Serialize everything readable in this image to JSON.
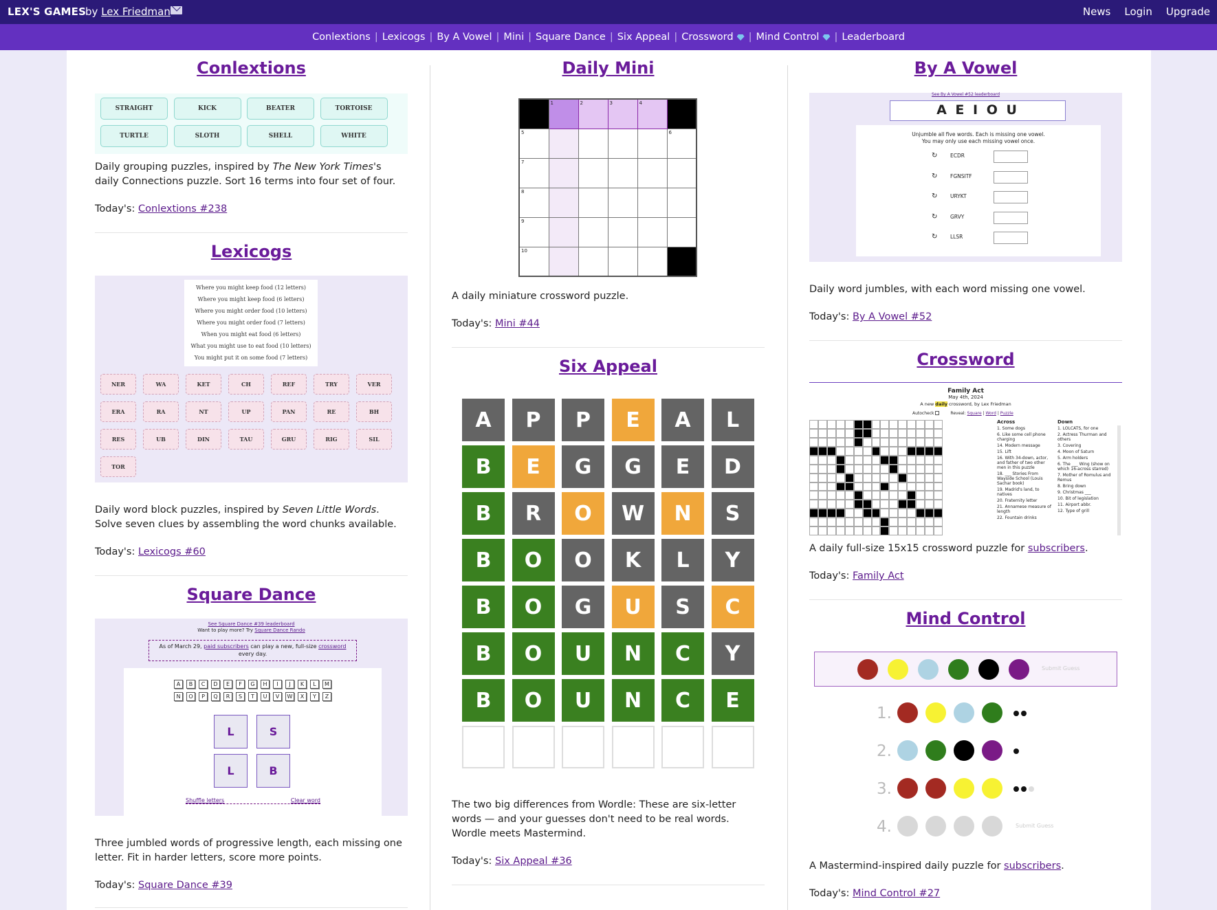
{
  "topbar": {
    "brand": "LEX'S GAMES",
    "by": "by",
    "author": "Lex Friedman",
    "links": [
      "News",
      "Login",
      "Upgrade"
    ]
  },
  "nav": {
    "items": [
      "Conlextions",
      "Lexicogs",
      "By A Vowel",
      "Mini",
      "Square Dance",
      "Six Appeal",
      "Crossword",
      "Mind Control",
      "Leaderboard"
    ],
    "gem_items": [
      "Crossword",
      "Mind Control"
    ]
  },
  "conlextions": {
    "title": "Conlextions",
    "tiles": [
      "STRAIGHT",
      "KICK",
      "BEATER",
      "TORTOISE",
      "TURTLE",
      "SLOTH",
      "SHELL",
      "WHITE"
    ],
    "desc_pre": "Daily grouping puzzles, inspired by ",
    "desc_em": "The New York Times",
    "desc_post": "'s daily Connections puzzle. Sort 16 terms into four set of four.",
    "today_label": "Today's:",
    "today_link": "Conlextions #238"
  },
  "lexicogs": {
    "title": "Lexicogs",
    "clues": [
      "Where you might keep food (12 letters)",
      "Where you might keep food (6 letters)",
      "Where you might order food (10 letters)",
      "Where you might order food (7 letters)",
      "When you might eat food (6 letters)",
      "What you might use to eat food (10 letters)",
      "You might put it on some food (7 letters)"
    ],
    "chunks": [
      "NER",
      "WA",
      "KET",
      "CH",
      "REF",
      "TRY",
      "VER",
      "ERA",
      "RA",
      "NT",
      "UP",
      "PAN",
      "RE",
      "BH",
      "RES",
      "UB",
      "DIN",
      "TAU",
      "GRU",
      "RIG",
      "SIL",
      "TOR"
    ],
    "desc_pre": "Daily word block puzzles, inspired by ",
    "desc_em": "Seven Little Words",
    "desc_post": ". Solve seven clues by assembling the word chunks available.",
    "today_label": "Today's:",
    "today_link": "Lexicogs #60"
  },
  "squaredance": {
    "title": "Square Dance",
    "lb_link": "See Square Dance #39 leaderboard",
    "more_pre": "Want to play more? Try ",
    "more_link": "Square Dance Rando",
    "notice_pre": "As of March 29, ",
    "notice_link": "paid subscribers",
    "notice_mid": " can play a new, full-size ",
    "notice_link2": "crossword",
    "notice_post": " every day.",
    "keys1": [
      "A",
      "B",
      "C",
      "D",
      "E",
      "F",
      "G",
      "H",
      "I",
      "J",
      "K",
      "L",
      "M"
    ],
    "keys2": [
      "N",
      "O",
      "P",
      "Q",
      "R",
      "S",
      "T",
      "U",
      "V",
      "W",
      "X",
      "Y",
      "Z"
    ],
    "grid": [
      "L",
      "S",
      "L",
      "B"
    ],
    "shuffle": "Shuffle letters",
    "clear": "Clear word",
    "desc": "Three jumbled words of progressive length, each missing one letter. Fit in harder letters, score more points.",
    "today_label": "Today's:",
    "today_link": "Square Dance #39"
  },
  "mini": {
    "title": "Daily Mini",
    "numbers": [
      "1",
      "2",
      "3",
      "4",
      "5",
      "6",
      "7",
      "8",
      "9",
      "10"
    ],
    "desc": "A daily miniature crossword puzzle.",
    "today_label": "Today's:",
    "today_link": "Mini #44"
  },
  "sixappeal": {
    "title": "Six Appeal",
    "rows": [
      [
        "A",
        "P",
        "P",
        "E",
        "A",
        "L"
      ],
      [
        "B",
        "E",
        "G",
        "G",
        "E",
        "D"
      ],
      [
        "B",
        "R",
        "O",
        "W",
        "N",
        "S"
      ],
      [
        "B",
        "O",
        "O",
        "K",
        "L",
        "Y"
      ],
      [
        "B",
        "O",
        "G",
        "U",
        "S",
        "C"
      ],
      [
        "B",
        "O",
        "U",
        "N",
        "C",
        "Y"
      ],
      [
        "B",
        "O",
        "U",
        "N",
        "C",
        "E"
      ],
      [
        "",
        "",
        "",
        "",
        "",
        ""
      ]
    ],
    "colors": [
      [
        "d",
        "d",
        "d",
        "y",
        "d",
        "d"
      ],
      [
        "g",
        "y",
        "d",
        "d",
        "d",
        "d"
      ],
      [
        "g",
        "d",
        "y",
        "d",
        "y",
        "d"
      ],
      [
        "g",
        "g",
        "d",
        "d",
        "d",
        "d"
      ],
      [
        "g",
        "g",
        "d",
        "y",
        "d",
        "y"
      ],
      [
        "g",
        "g",
        "g",
        "g",
        "g",
        "d"
      ],
      [
        "g",
        "g",
        "g",
        "g",
        "g",
        "g"
      ],
      [
        "e",
        "e",
        "e",
        "e",
        "e",
        "e"
      ]
    ],
    "desc": "The two big differences from Wordle: These are six-letter words — and your guesses don't need to be real words. Wordle meets Mastermind.",
    "today_label": "Today's:",
    "today_link": "Six Appeal #36"
  },
  "byavowel": {
    "title": "By A Vowel",
    "lb_link": "See By A Vowel #52 leaderboard",
    "vowels": "A E I O U",
    "instr1": "Unjumble all five words. Each is missing one vowel.",
    "instr2": "You may only use each missing vowel once.",
    "words": [
      "ECDR",
      "FGNSITF",
      "URYKT",
      "GRVY",
      "LLSR"
    ],
    "desc": "Daily word jumbles, with each word missing one vowel.",
    "today_label": "Today's:",
    "today_link": "By A Vowel #52"
  },
  "crossword": {
    "title": "Crossword",
    "puzzle_title": "Family Act",
    "date": "May 4th, 2024",
    "byline_pre": "A new ",
    "byline_hl": "daily",
    "byline_post": " crossword, by Lex Friedman",
    "autocheck": "Autocheck",
    "reveal": "Reveal:",
    "reveal_opts": [
      "Square",
      "Word",
      "Puzzle"
    ],
    "across_title": "Across",
    "across": [
      "1. Some dogs",
      "6. Like some cell phone charging",
      "14. Modern message",
      "15. Lift",
      "16. With 34-down, actor, and father of two other men in this puzzle",
      "18. ___ Stories From Wayside School (Louis Sachar book)",
      "19. Madrid's land, to natives",
      "20. Fraternity letter",
      "21. Annamese measure of length",
      "22. Fountain drinks"
    ],
    "down_title": "Down",
    "down": [
      "1. LOLCATS, for one",
      "2. Actress Thurman and others",
      "3. Covering",
      "4. Moon of Saturn",
      "5. Arm holders",
      "6. The ___ Wing (show on which 16-across starred)",
      "7. Mother of Romulus and Remus",
      "8. Bring down",
      "9. Christmas ___",
      "10. Bit of legislation",
      "11. Airport abbr.",
      "12. Type of grill"
    ],
    "desc_pre": "A daily full-size 15x15 crossword puzzle for ",
    "desc_link": "subscribers",
    "desc_post": ".",
    "today_label": "Today's:",
    "today_link": "Family Act"
  },
  "mindcontrol": {
    "title": "Mind Control",
    "submit": "Submit Guess",
    "palette": [
      "#a32a22",
      "#f7f233",
      "#aed3e3",
      "#2f7d1c",
      "#000000",
      "#7a1a86"
    ],
    "guesses": [
      {
        "num": "1.",
        "pegs": [
          "#a32a22",
          "#f7f233",
          "#aed3e3",
          "#2f7d1c"
        ],
        "black": 2,
        "gray": 0
      },
      {
        "num": "2.",
        "pegs": [
          "#aed3e3",
          "#2f7d1c",
          "#000000",
          "#7a1a86"
        ],
        "black": 1,
        "gray": 0
      },
      {
        "num": "3.",
        "pegs": [
          "#a32a22",
          "#a32a22",
          "#f7f233",
          "#f7f233"
        ],
        "black": 2,
        "gray": 1
      },
      {
        "num": "4.",
        "pegs": [
          "#d8d8d8",
          "#d8d8d8",
          "#d8d8d8",
          "#d8d8d8"
        ],
        "black": 0,
        "gray": 0
      }
    ],
    "desc_pre": "A Mastermind-inspired daily puzzle for ",
    "desc_link": "subscribers",
    "desc_post": ".",
    "today_label": "Today's:",
    "today_link": "Mind Control #27"
  }
}
